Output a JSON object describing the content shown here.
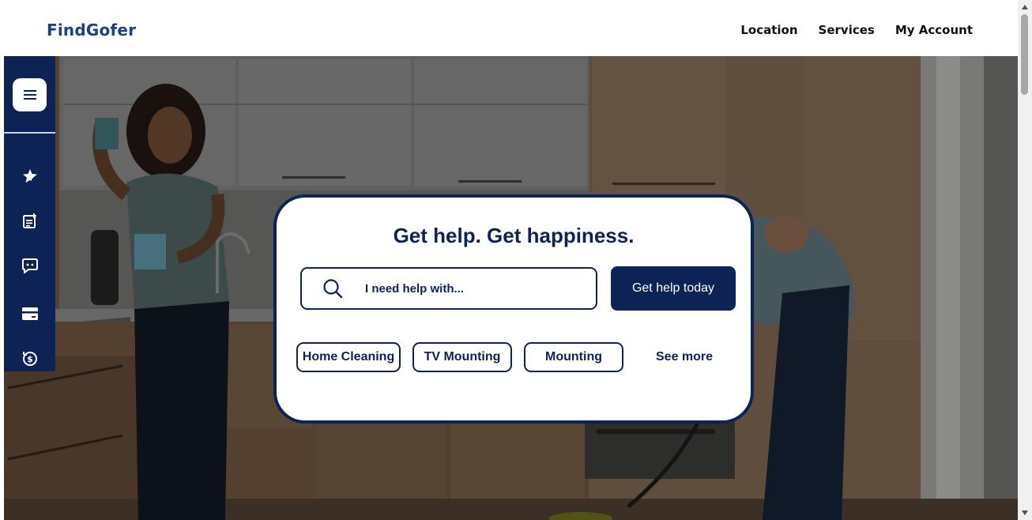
{
  "header": {
    "logo": "FindGofer",
    "nav": [
      "Location",
      "Services",
      "My Account"
    ]
  },
  "sidebar": {
    "menu_icon": "hamburger-icon",
    "icons": [
      "star-badge-icon",
      "note-add-icon",
      "chat-icon",
      "card-icon",
      "dollar-cycle-icon"
    ]
  },
  "hero": {
    "title": "Get help. Get happiness.",
    "search_placeholder": "I need help with...",
    "cta_label": "Get help today",
    "chips": [
      "Home Cleaning",
      "TV Mounting",
      "Mounting"
    ],
    "see_more": "See more"
  },
  "colors": {
    "brand": "#1e3f86",
    "navy": "#0d2255"
  }
}
